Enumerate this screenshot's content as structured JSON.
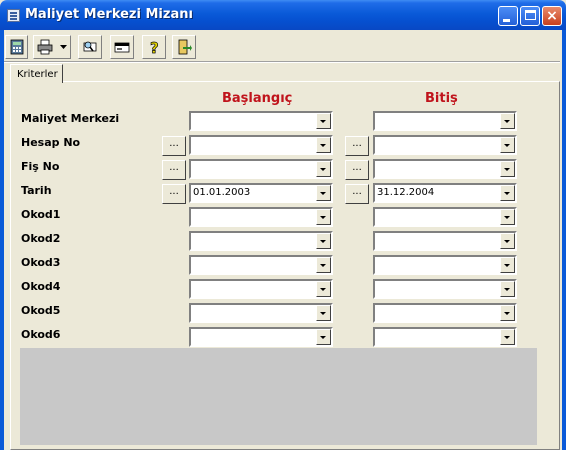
{
  "window": {
    "title": "Maliyet Merkezi Mizanı"
  },
  "toolbar": {
    "buttons": [
      {
        "icon": "calculator-icon",
        "name": "calculate"
      },
      {
        "icon": "printer-icon",
        "name": "print"
      },
      {
        "icon": "preview-icon",
        "name": "preview"
      },
      {
        "icon": "card-icon",
        "name": "card"
      },
      {
        "icon": "help-icon",
        "name": "help"
      },
      {
        "icon": "exit-icon",
        "name": "exit"
      }
    ]
  },
  "tabs": [
    {
      "label": "Kriterler"
    }
  ],
  "headers": {
    "start": "Başlangıç",
    "end": "Bitiş"
  },
  "rows": [
    {
      "label": "Maliyet Merkezi",
      "start": "",
      "end": "",
      "has_buttons": false
    },
    {
      "label": "Hesap No",
      "start": "",
      "end": "",
      "has_buttons": true
    },
    {
      "label": "Fiş No",
      "start": "",
      "end": "",
      "has_buttons": true
    },
    {
      "label": "Tarih",
      "start": "01.01.2003",
      "end": "31.12.2004",
      "has_buttons": true
    },
    {
      "label": "Okod1",
      "start": "",
      "end": "",
      "has_buttons": false
    },
    {
      "label": "Okod2",
      "start": "",
      "end": "",
      "has_buttons": false
    },
    {
      "label": "Okod3",
      "start": "",
      "end": "",
      "has_buttons": false
    },
    {
      "label": "Okod4",
      "start": "",
      "end": "",
      "has_buttons": false
    },
    {
      "label": "Okod5",
      "start": "",
      "end": "",
      "has_buttons": false
    },
    {
      "label": "Okod6",
      "start": "",
      "end": "",
      "has_buttons": false
    }
  ],
  "ellipsis": "...",
  "close_glyph": "×"
}
